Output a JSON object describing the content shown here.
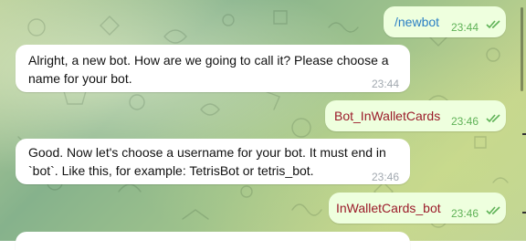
{
  "messages": [
    {
      "side": "out",
      "text": "/newbot",
      "time": "23:44",
      "status": "double-check-read"
    },
    {
      "side": "in",
      "text": "Alright, a new bot. How are we going to call it? Please choose a name for your bot.",
      "time": "23:44"
    },
    {
      "side": "out",
      "text": "Bot_InWalletCards",
      "time": "23:46",
      "status": "double-check-read"
    },
    {
      "side": "in",
      "text": "Good. Now let's choose a username for your bot. It must end in `bot`. Like this, for example: TetrisBot or tetris_bot.",
      "time": "23:46"
    },
    {
      "side": "out",
      "text": "InWalletCards_bot",
      "time": "23:46",
      "status": "double-check-read"
    }
  ],
  "colors": {
    "outgoing_bubble": "#eeffde",
    "incoming_bubble": "#ffffff",
    "outgoing_text": "#9b1b2a",
    "outgoing_time": "#5fb257",
    "incoming_time": "#a2a9b0",
    "background": "#a9c79a"
  },
  "icons": {
    "read_receipt": "double-check-icon"
  }
}
